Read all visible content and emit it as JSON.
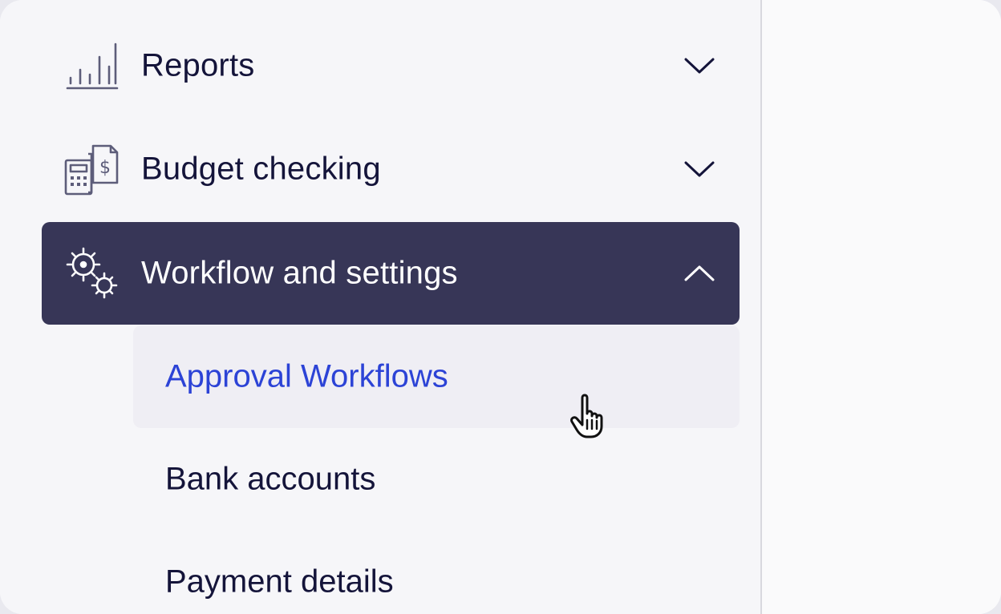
{
  "nav": {
    "items": [
      {
        "label": "Reports",
        "icon": "bar-chart-icon",
        "expanded": false
      },
      {
        "label": "Budget checking",
        "icon": "calculator-dollar-icon",
        "expanded": false
      },
      {
        "label": "Workflow and settings",
        "icon": "gears-icon",
        "expanded": true
      }
    ],
    "sub_items": [
      {
        "label": "Approval Workflows",
        "state": "hover"
      },
      {
        "label": "Bank accounts"
      },
      {
        "label": "Payment details"
      }
    ]
  },
  "colors": {
    "active_bg": "#373657",
    "hover_bg": "#efeef4",
    "link_blue": "#2c43d6",
    "text": "#14143a"
  }
}
